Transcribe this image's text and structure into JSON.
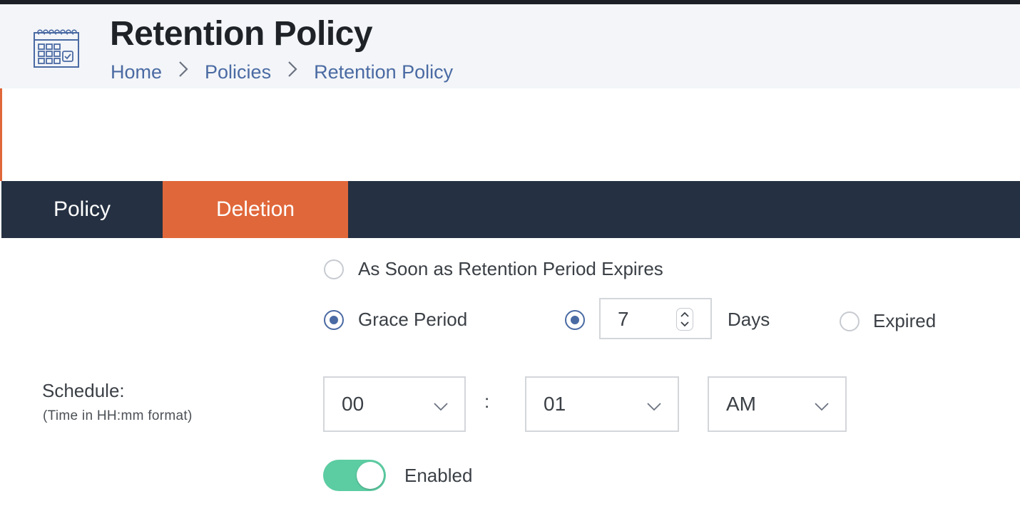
{
  "header": {
    "title": "Retention Policy",
    "icon": "calendar-icon",
    "breadcrumb": [
      "Home",
      "Policies",
      "Retention Policy"
    ],
    "separator": ">"
  },
  "tabs": [
    {
      "label": "Policy",
      "active": false
    },
    {
      "label": "Deletion",
      "active": true
    }
  ],
  "deletion": {
    "options": {
      "immediate": {
        "label": "As Soon as Retention Period Expires",
        "selected": false
      },
      "grace": {
        "label": "Grace Period",
        "selected": true
      }
    },
    "grace_period": {
      "days_selected": true,
      "days_value": "7",
      "days_unit": "Days",
      "expired_label": "Expired",
      "expired_selected": false
    },
    "schedule": {
      "label": "Schedule:",
      "hint": "(Time in HH:mm format)",
      "hour": "00",
      "separator": ":",
      "minute": "01",
      "meridiem": "AM"
    },
    "enabled": {
      "label": "Enabled",
      "on": true
    }
  },
  "colors": {
    "accent": "#e0673a",
    "tabbar": "#253142",
    "link": "#4a6aa3",
    "toggle_on": "#5ccca2"
  }
}
